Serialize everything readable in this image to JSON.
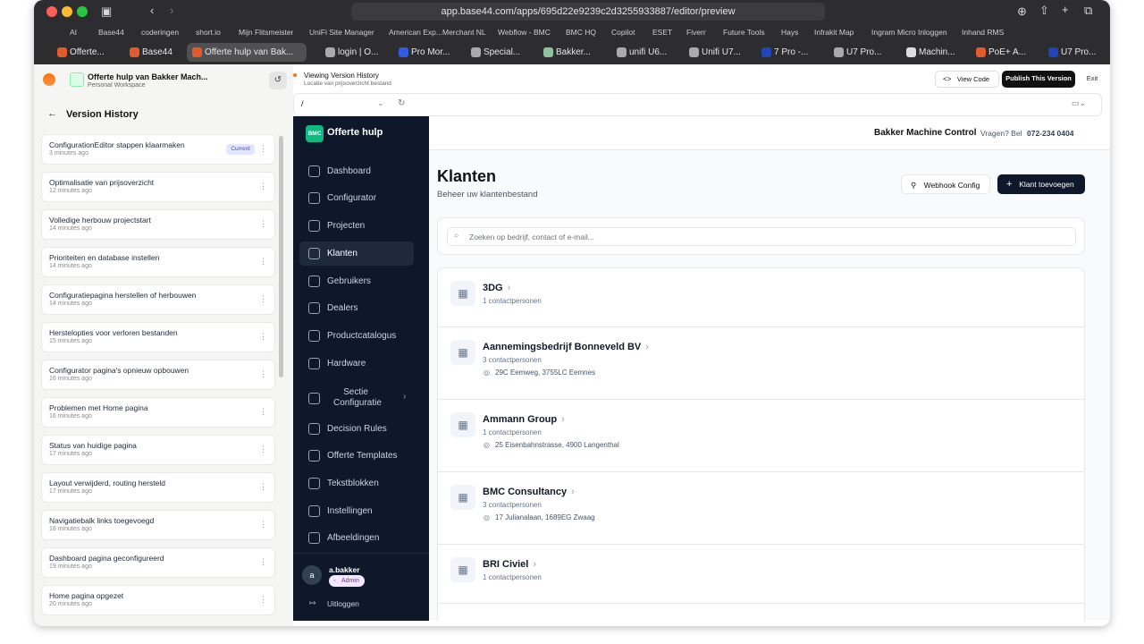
{
  "browser": {
    "url": "app.base44.com/apps/695d22e9239c2d3255933887/editor/preview",
    "bookmarks": [
      "AI",
      "Base44",
      "coderingen",
      "short.io",
      "Mijn Flitsmeister",
      "UniFi Site Manager",
      "American Exp...Merchant NL",
      "Webflow - BMC",
      "BMC HQ",
      "Copilot",
      "ESET",
      "Fiverr",
      "Future Tools",
      "Hays",
      "Infrakit Map",
      "Ingram Micro Inloggen",
      "Inhand RMS"
    ],
    "tabs": [
      "Offerte...",
      "Base44",
      "Offerte hulp van Bak...",
      "login | O...",
      "Pro Mor...",
      "Special...",
      "Bakker...",
      "unifi U6...",
      "Unifi U7...",
      "7 Pro -...",
      "U7 Pro...",
      "Machin...",
      "PoE+ A...",
      "U7 Pro..."
    ]
  },
  "editor": {
    "app_name": "Offerte hulp van Bakker Mach...",
    "workspace": "Personal Workspace",
    "viewing_title": "Viewing Version History",
    "viewing_sub": "Locatie van prijsoverzicht bestand",
    "view_code": "View Code",
    "publish": "Publish This Version",
    "exit": "Exit",
    "path": "/"
  },
  "version_history": {
    "title": "Version History",
    "current_badge": "Current",
    "items": [
      {
        "title": "ConfigurationEditor stappen klaarmaken",
        "time": "3 minutes ago"
      },
      {
        "title": "Optimalisatie van prijsoverzicht",
        "time": "12 minutes ago"
      },
      {
        "title": "Volledige herbouw projectstart",
        "time": "14 minutes ago"
      },
      {
        "title": "Prioriteiten en database instellen",
        "time": "14 minutes ago"
      },
      {
        "title": "Configuratiepagina herstellen of herbouwen",
        "time": "14 minutes ago"
      },
      {
        "title": "Herstelopties voor verloren bestanden",
        "time": "15 minutes ago"
      },
      {
        "title": "Configurator pagina's opnieuw opbouwen",
        "time": "16 minutes ago"
      },
      {
        "title": "Problemen met Home pagina",
        "time": "16 minutes ago"
      },
      {
        "title": "Status van huidige pagina",
        "time": "17 minutes ago"
      },
      {
        "title": "Layout verwijderd, routing hersteld",
        "time": "17 minutes ago"
      },
      {
        "title": "Navigatiebalk links toegevoegd",
        "time": "18 minutes ago"
      },
      {
        "title": "Dashboard pagina geconfigureerd",
        "time": "19 minutes ago"
      },
      {
        "title": "Home pagina opgezet",
        "time": "20 minutes ago"
      }
    ]
  },
  "app": {
    "logo_badge": "BMC",
    "logo_text": "Offerte hulp",
    "company": "Bakker Machine Control",
    "ask": "Vragen? Bel",
    "phone": "072-234 0404",
    "nav": [
      "Dashboard",
      "Configurator",
      "Projecten",
      "Klanten",
      "Gebruikers",
      "Dealers",
      "Productcatalogus",
      "Hardware",
      "Sectie Configuratie",
      "Decision Rules",
      "Offerte Templates",
      "Tekstblokken",
      "Instellingen",
      "Afbeeldingen"
    ],
    "user": {
      "initial": "a",
      "name": "a.bakker",
      "role": "Admin",
      "logout": "Uitloggen"
    },
    "page_title": "Klanten",
    "page_sub": "Beheer uw klantenbestand",
    "webhook": "Webhook Config",
    "add_client": "Klant toevoegen",
    "search_placeholder": "Zoeken op bedrijf, contact of e-mail...",
    "clients": [
      {
        "name": "3DG",
        "contacts": "1 contactpersonen",
        "address": ""
      },
      {
        "name": "Aannemingsbedrijf Bonneveld BV",
        "contacts": "3 contactpersonen",
        "address": "29C Eemweg, 3755LC Eemnes"
      },
      {
        "name": "Ammann Group",
        "contacts": "1 contactpersonen",
        "address": "25 Eisenbahnstrasse, 4900 Langenthal"
      },
      {
        "name": "BMC Consultancy",
        "contacts": "3 contactpersonen",
        "address": "17 Julianalaan, 1689EG Zwaag"
      },
      {
        "name": "BRI Civiel",
        "contacts": "1 contactpersonen",
        "address": ""
      }
    ]
  }
}
